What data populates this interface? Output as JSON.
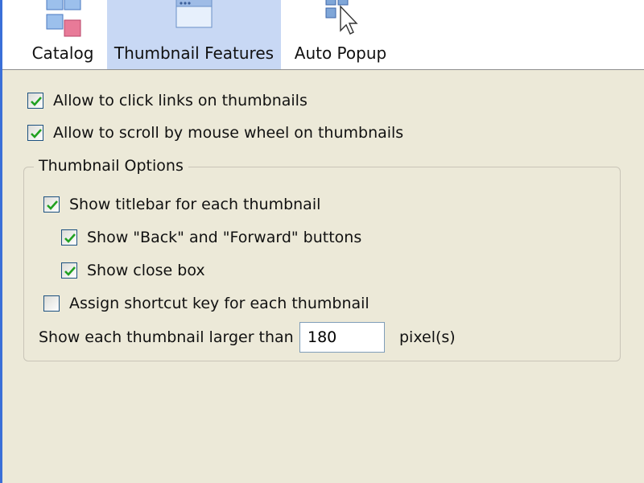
{
  "toolbar": {
    "tabs": [
      {
        "label": "Catalog",
        "icon": "catalog-icon",
        "active": false
      },
      {
        "label": "Thumbnail Features",
        "icon": "thumbnail-window-icon",
        "active": true
      },
      {
        "label": "Auto Popup",
        "icon": "auto-popup-icon",
        "active": false
      }
    ]
  },
  "options": {
    "click_links": {
      "label": "Allow to click links on thumbnails",
      "checked": true
    },
    "scroll_wheel": {
      "label": "Allow to scroll by mouse wheel on thumbnails",
      "checked": true
    }
  },
  "thumbnail_options": {
    "title": "Thumbnail Options",
    "show_titlebar": {
      "label": "Show titlebar for each thumbnail",
      "checked": true
    },
    "back_forward": {
      "label": "Show \"Back\" and \"Forward\" buttons",
      "checked": true
    },
    "close_box": {
      "label": "Show close box",
      "checked": true
    },
    "shortcut_key": {
      "label": "Assign shortcut key for each thumbnail",
      "checked": false
    },
    "size": {
      "label": "Show each thumbnail larger than",
      "value": "180",
      "unit": "pixel(s)"
    }
  },
  "colors": {
    "panel_bg": "#ece9d8",
    "active_tab": "#c8d8f4",
    "check_green": "#21a121",
    "window_border": "#3a6fd8"
  }
}
